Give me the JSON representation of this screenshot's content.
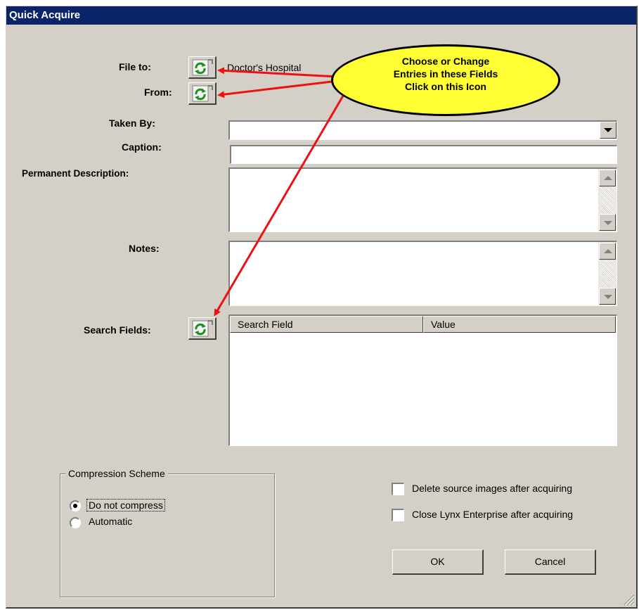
{
  "window": {
    "title": "Quick Acquire"
  },
  "fields": {
    "file_to": {
      "label": "File to:",
      "value": "Doctor's Hospital"
    },
    "from": {
      "label": "From:"
    },
    "taken_by": {
      "label": "Taken By:",
      "value": ""
    },
    "caption": {
      "label": "Caption:",
      "value": ""
    },
    "permanent_description": {
      "label": "Permanent Description:",
      "value": ""
    },
    "notes": {
      "label": "Notes:",
      "value": ""
    },
    "search_fields": {
      "label": "Search Fields:",
      "columns": [
        "Search Field",
        "Value"
      ],
      "rows": []
    }
  },
  "compression": {
    "title": "Compression Scheme",
    "options": [
      {
        "label": "Do not compress",
        "selected": true
      },
      {
        "label": "Automatic",
        "selected": false
      }
    ]
  },
  "options": {
    "delete_source": {
      "label": "Delete source images after acquiring",
      "checked": false
    },
    "close_lynx": {
      "label": "Close Lynx Enterprise after acquiring",
      "checked": false
    }
  },
  "buttons": {
    "ok": "OK",
    "cancel": "Cancel"
  },
  "callout": {
    "lines": [
      "Choose or Change",
      "Entries in these Fields",
      "Click on this Icon"
    ],
    "fill": "#ffff33",
    "arrow_color": "#ee1111"
  },
  "icons": {
    "picker": "refresh-picker-icon",
    "dropdown": "chevron-down-icon"
  },
  "colors": {
    "titlebar": "#0a246a",
    "dialog": "#d4d0c8"
  }
}
